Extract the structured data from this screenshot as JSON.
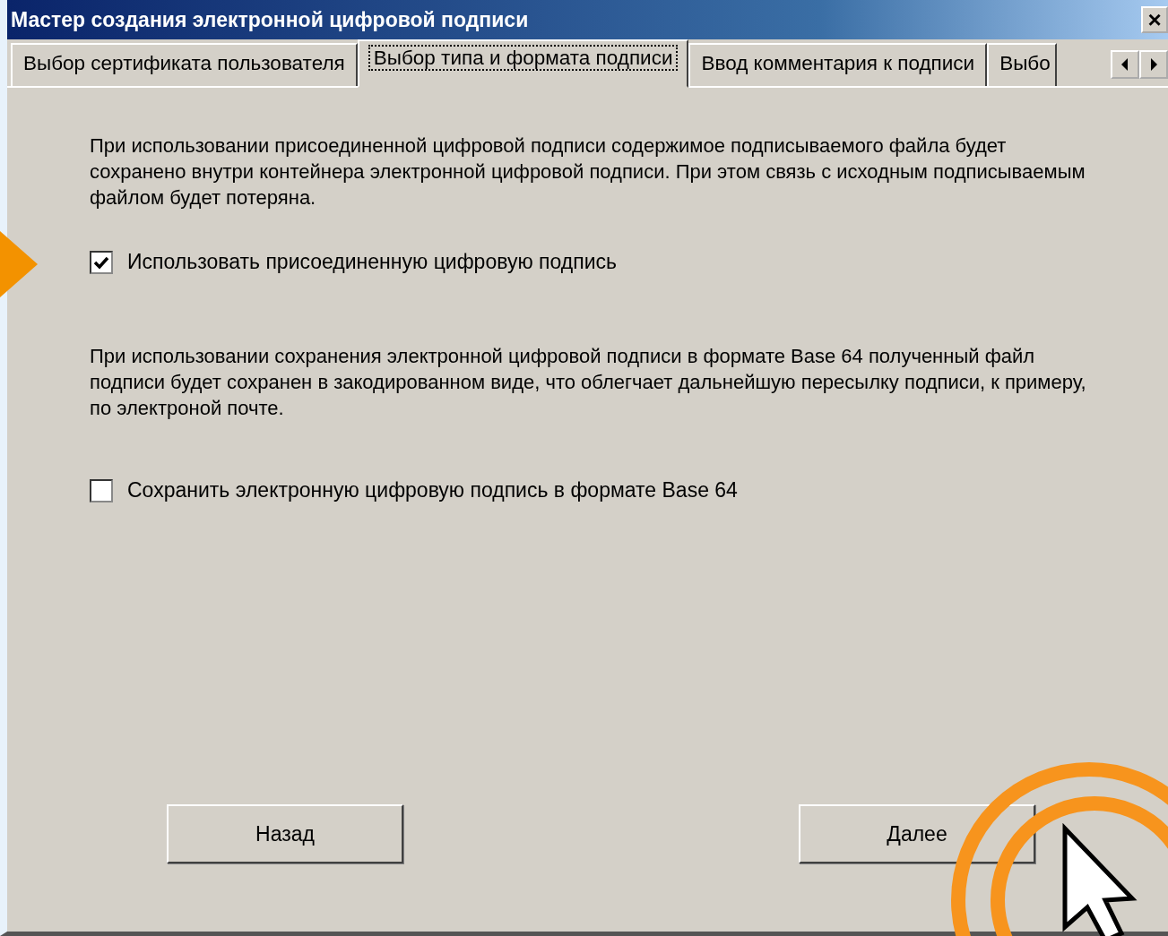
{
  "window": {
    "title": "Мастер создания электронной цифровой подписи",
    "close": "×"
  },
  "tabs": [
    {
      "label": "Выбор сертификата пользователя",
      "selected": false
    },
    {
      "label": "Выбор типа и формата подписи",
      "selected": true
    },
    {
      "label": "Ввод комментария к подписи",
      "selected": false
    },
    {
      "label": "Выбо",
      "selected": false
    }
  ],
  "sections": [
    {
      "description": "При использовании присоединенной цифровой подписи содержимое подписываемого файла будет сохранено внутри контейнера электронной цифровой подписи. При этом связь с исходным подписываемым файлом будет потеряна.",
      "option": {
        "label": "Использовать присоединенную цифровую подпись",
        "checked": true
      }
    },
    {
      "description": "При использовании сохранения электронной цифровой подписи в формате Base 64 полученный файл подписи будет сохранен в закодированном виде, что облегчает дальнейшую пересылку подписи, к примеру, по электроной почте.",
      "option": {
        "label": "Сохранить электронную цифровую подпись в формате Base 64",
        "checked": false
      }
    }
  ],
  "buttons": [
    {
      "label": "Назад"
    },
    {
      "label": "Далее"
    }
  ]
}
